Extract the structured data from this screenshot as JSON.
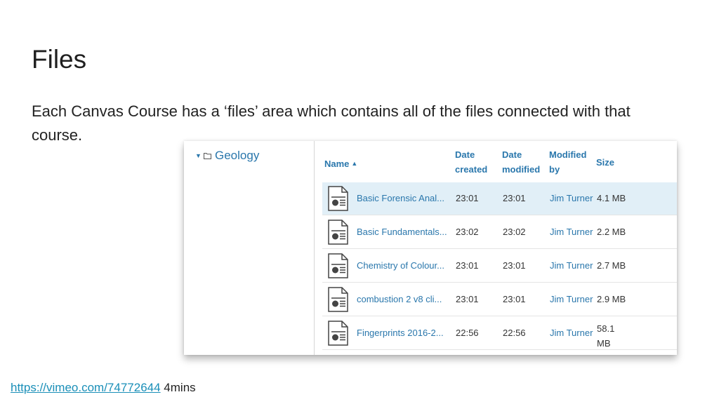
{
  "slide": {
    "title": "Files",
    "body": "Each Canvas Course has a ‘files’ area which contains all of the files connected with that course.",
    "link_text": "https://vimeo.com/74772644",
    "link_suffix": " 4mins"
  },
  "folder_tree": {
    "caret_icon": "triangle-down-icon",
    "folder_icon": "folder-icon",
    "root": "Geology"
  },
  "columns": {
    "name": "Name",
    "sort_icon": "▲",
    "date_created": [
      "Date",
      "created"
    ],
    "date_modified": [
      "Date",
      "modified"
    ],
    "modified_by": [
      "Modified",
      "by"
    ],
    "size": "Size"
  },
  "files": [
    {
      "name": "Basic Forensic Anal...",
      "created": "23:01",
      "modified": "23:01",
      "by": "Jim Turner",
      "size": "4.1 MB",
      "selected": true
    },
    {
      "name": "Basic Fundamentals...",
      "created": "23:02",
      "modified": "23:02",
      "by": "Jim Turner",
      "size": "2.2 MB",
      "selected": false
    },
    {
      "name": "Chemistry of Colour...",
      "created": "23:01",
      "modified": "23:01",
      "by": "Jim Turner",
      "size": "2.7 MB",
      "selected": false
    },
    {
      "name": "combustion 2 v8 cli...",
      "created": "23:01",
      "modified": "23:01",
      "by": "Jim Turner",
      "size": "2.9 MB",
      "selected": false
    },
    {
      "name": "Fingerprints 2016-2...",
      "created": "22:56",
      "modified": "22:56",
      "by": "Jim Turner",
      "size": "58.1 MB",
      "selected": false
    }
  ],
  "colors": {
    "link": "#2a77ac",
    "selected_row": "#e1eff7",
    "footer_link": "#1a8fb8"
  }
}
